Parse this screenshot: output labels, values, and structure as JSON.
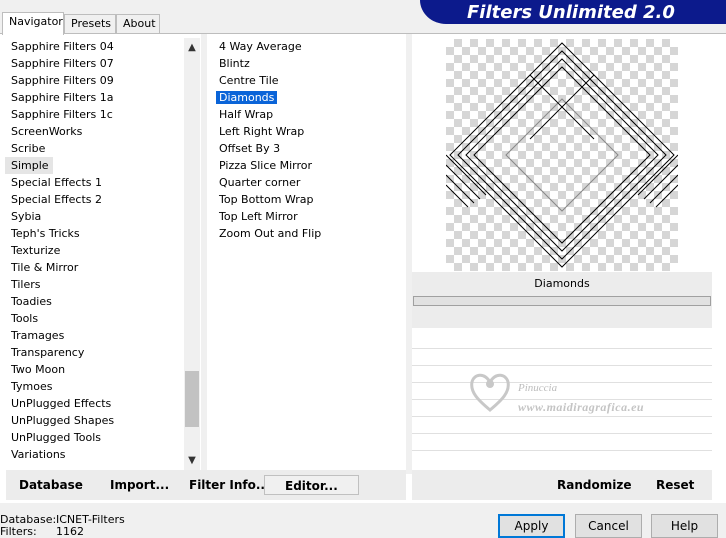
{
  "tabs": [
    {
      "label": "Navigator"
    },
    {
      "label": "Presets"
    },
    {
      "label": "About"
    }
  ],
  "banner": {
    "title": "Filters Unlimited 2.0"
  },
  "categories": [
    "Sapphire Filters 04",
    "Sapphire Filters 07",
    "Sapphire Filters 09",
    "Sapphire Filters 1a",
    "Sapphire Filters 1c",
    "ScreenWorks",
    "Scribe",
    "Simple",
    "Special Effects 1",
    "Special Effects 2",
    "Sybia",
    "Teph's Tricks",
    "Texturize",
    "Tile & Mirror",
    "Tilers",
    "Toadies",
    "Tools",
    "Tramages",
    "Transparency",
    "Two Moon",
    "Tymoes",
    "UnPlugged Effects",
    "UnPlugged Shapes",
    "UnPlugged Tools",
    "Variations"
  ],
  "filters": [
    "4 Way Average",
    "Blintz",
    "Centre Tile",
    "Diamonds",
    "Half Wrap",
    "Left Right Wrap",
    "Offset By 3",
    "Pizza Slice Mirror",
    "Quarter corner",
    "Top Bottom Wrap",
    "Top Left Mirror",
    "Zoom Out and Flip"
  ],
  "selected_category": "Simple",
  "selected_filter": "Diamonds",
  "preview": {
    "filter_name": "Diamonds"
  },
  "watermark": {
    "line1": "Pinuccia",
    "line2": "www.maidiragrafica.eu"
  },
  "bottom_bar": {
    "database": "Database",
    "import": "Import...",
    "filter_info": "Filter Info...",
    "editor": "Editor...",
    "randomize": "Randomize",
    "reset": "Reset"
  },
  "footer": {
    "database_label": "Database:",
    "database_value": "ICNET-Filters",
    "filters_label": "Filters:",
    "filters_value": "1162"
  },
  "dialog_buttons": {
    "apply": "Apply",
    "cancel": "Cancel",
    "help": "Help"
  },
  "colors": {
    "banner": "#0c1a8c",
    "selection": "#0a64d8",
    "default_button_border": "#0078d7"
  },
  "icons": {
    "scroll_up": "chevron-up-icon",
    "scroll_down": "chevron-down-icon",
    "watermark": "heart-logo-icon"
  }
}
